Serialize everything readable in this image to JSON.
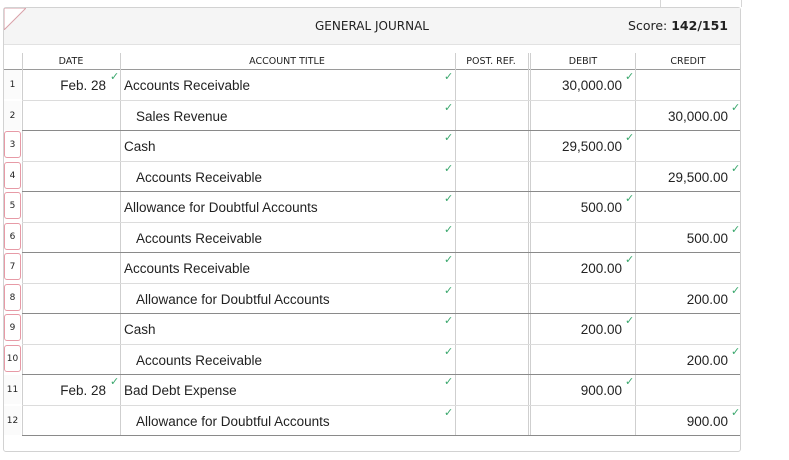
{
  "journal": {
    "title": "GENERAL JOURNAL",
    "score_label": "Score:",
    "score_value": "142/151"
  },
  "columns": {
    "date": "DATE",
    "account": "ACCOUNT TITLE",
    "post_ref": "POST. REF.",
    "debit": "DEBIT",
    "credit": "CREDIT"
  },
  "rows": [
    {
      "num": "1",
      "date": "Feb. 28",
      "account": "Accounts Receivable",
      "indent": false,
      "debit": "30,000.00",
      "credit": ""
    },
    {
      "num": "2",
      "date": "",
      "account": "Sales Revenue",
      "indent": true,
      "debit": "",
      "credit": "30,000.00"
    },
    {
      "num": "3",
      "date": "",
      "account": "Cash",
      "indent": false,
      "debit": "29,500.00",
      "credit": ""
    },
    {
      "num": "4",
      "date": "",
      "account": "Accounts Receivable",
      "indent": true,
      "debit": "",
      "credit": "29,500.00"
    },
    {
      "num": "5",
      "date": "",
      "account": "Allowance for Doubtful Accounts",
      "indent": false,
      "debit": "500.00",
      "credit": ""
    },
    {
      "num": "6",
      "date": "",
      "account": "Accounts Receivable",
      "indent": true,
      "debit": "",
      "credit": "500.00"
    },
    {
      "num": "7",
      "date": "",
      "account": "Accounts Receivable",
      "indent": false,
      "debit": "200.00",
      "credit": ""
    },
    {
      "num": "8",
      "date": "",
      "account": "Allowance for Doubtful Accounts",
      "indent": true,
      "debit": "",
      "credit": "200.00"
    },
    {
      "num": "9",
      "date": "",
      "account": "Cash",
      "indent": false,
      "debit": "200.00",
      "credit": ""
    },
    {
      "num": "10",
      "date": "",
      "account": "Accounts Receivable",
      "indent": true,
      "debit": "",
      "credit": "200.00"
    },
    {
      "num": "11",
      "date": "Feb. 28",
      "account": "Bad Debt Expense",
      "indent": false,
      "debit": "900.00",
      "credit": ""
    },
    {
      "num": "12",
      "date": "",
      "account": "Allowance for Doubtful Accounts",
      "indent": true,
      "debit": "",
      "credit": "900.00"
    }
  ],
  "check_icon": "checkmark-icon",
  "colors": {
    "check": "#3aa76d",
    "marked_row_border": "#e79aa6",
    "entry_separator": "#8a8a8a"
  }
}
